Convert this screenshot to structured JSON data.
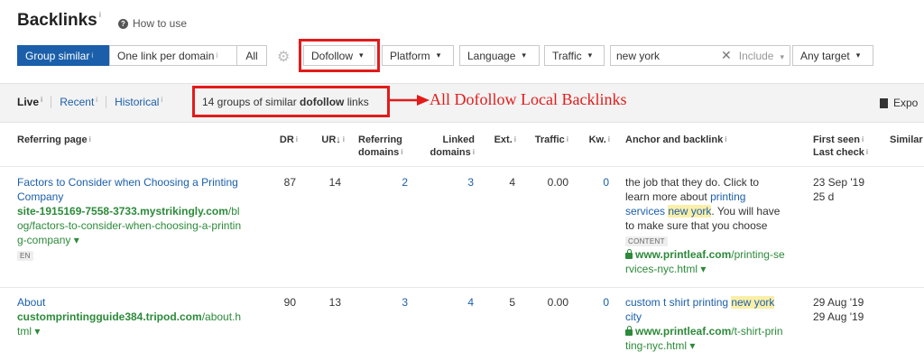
{
  "header": {
    "title": "Backlinks",
    "title_info": "i",
    "how_to_use": "How to use",
    "help_icon_glyph": "?"
  },
  "toolbar": {
    "group_similar": "Group similar",
    "one_link_per_domain": "One link per domain",
    "all": "All",
    "dofollow": "Dofollow",
    "platform": "Platform",
    "language": "Language",
    "traffic": "Traffic",
    "search_value": "new york",
    "include": "Include",
    "any_target": "Any target"
  },
  "tabs": {
    "live": "Live",
    "recent": "Recent",
    "historical": "Historical"
  },
  "summary": {
    "prefix": "14 groups of similar ",
    "bold": "dofollow",
    "suffix": " links"
  },
  "annotation": "All Dofollow Local Backlinks",
  "export": "Expo",
  "columns": {
    "referring_page": "Referring page",
    "dr": "DR",
    "ur": "UR",
    "ur_sort": "↓",
    "ref_domains_1": "Referring",
    "ref_domains_2": "domains",
    "linked_domains_1": "Linked",
    "linked_domains_2": "domains",
    "ext": "Ext.",
    "traffic": "Traffic",
    "kw": "Kw.",
    "anchor": "Anchor and backlink",
    "first_seen": "First seen",
    "last_check": "Last check",
    "similar": "Similar"
  },
  "rows": [
    {
      "title_1": "Factors to Consider when Choosing a Printing",
      "title_2": "Company",
      "url_host": "site-1915169-7558-3733.mystrikingly.com",
      "url_path_1": "/bl",
      "url_path_2": "og/factors-to-consider-when-choosing-a-printin",
      "url_path_3": "g-company",
      "lang": "EN",
      "dr": "87",
      "ur": "14",
      "ref_domains": "2",
      "linked_domains": "3",
      "ext": "4",
      "traffic": "0.00",
      "kw": "0",
      "anchor_1": "the job that they do. Click to",
      "anchor_2a": "learn more about ",
      "anchor_2b": "printing",
      "anchor_3a": "services",
      "anchor_3b": "new york",
      "anchor_3c": ". You will have",
      "anchor_4": "to make sure that you choose",
      "anchor_badge": "CONTENT",
      "backlink_host": "www.printleaf.com",
      "backlink_path_1": "/printing-se",
      "backlink_path_2": "rvices-nyc.html",
      "first_seen": "23 Sep '19",
      "last_check": "25 d"
    },
    {
      "title_1": "About",
      "url_host": "customprintingguide384.tripod.com",
      "url_path_1": "/about.h",
      "url_path_2": "tml",
      "dr": "90",
      "ur": "13",
      "ref_domains": "3",
      "linked_domains": "4",
      "ext": "5",
      "traffic": "0.00",
      "kw": "0",
      "anchor_1a": "custom t shirt printing ",
      "anchor_1b": "new york",
      "anchor_2": "city",
      "backlink_host": "www.printleaf.com",
      "backlink_path_1": "/t-shirt-prin",
      "backlink_path_2": "ting-nyc.html",
      "first_seen": "29 Aug '19",
      "last_check": "29 Aug '19"
    }
  ],
  "glyphs": {
    "caret": "▾",
    "caret_small": "▾",
    "clear": "✕",
    "gear": "⚙",
    "info": "i"
  },
  "colors": {
    "accent": "#1b5faa",
    "annotation": "#e21b1b",
    "url_green": "#2c8a3a",
    "highlight": "#fbefa8"
  }
}
